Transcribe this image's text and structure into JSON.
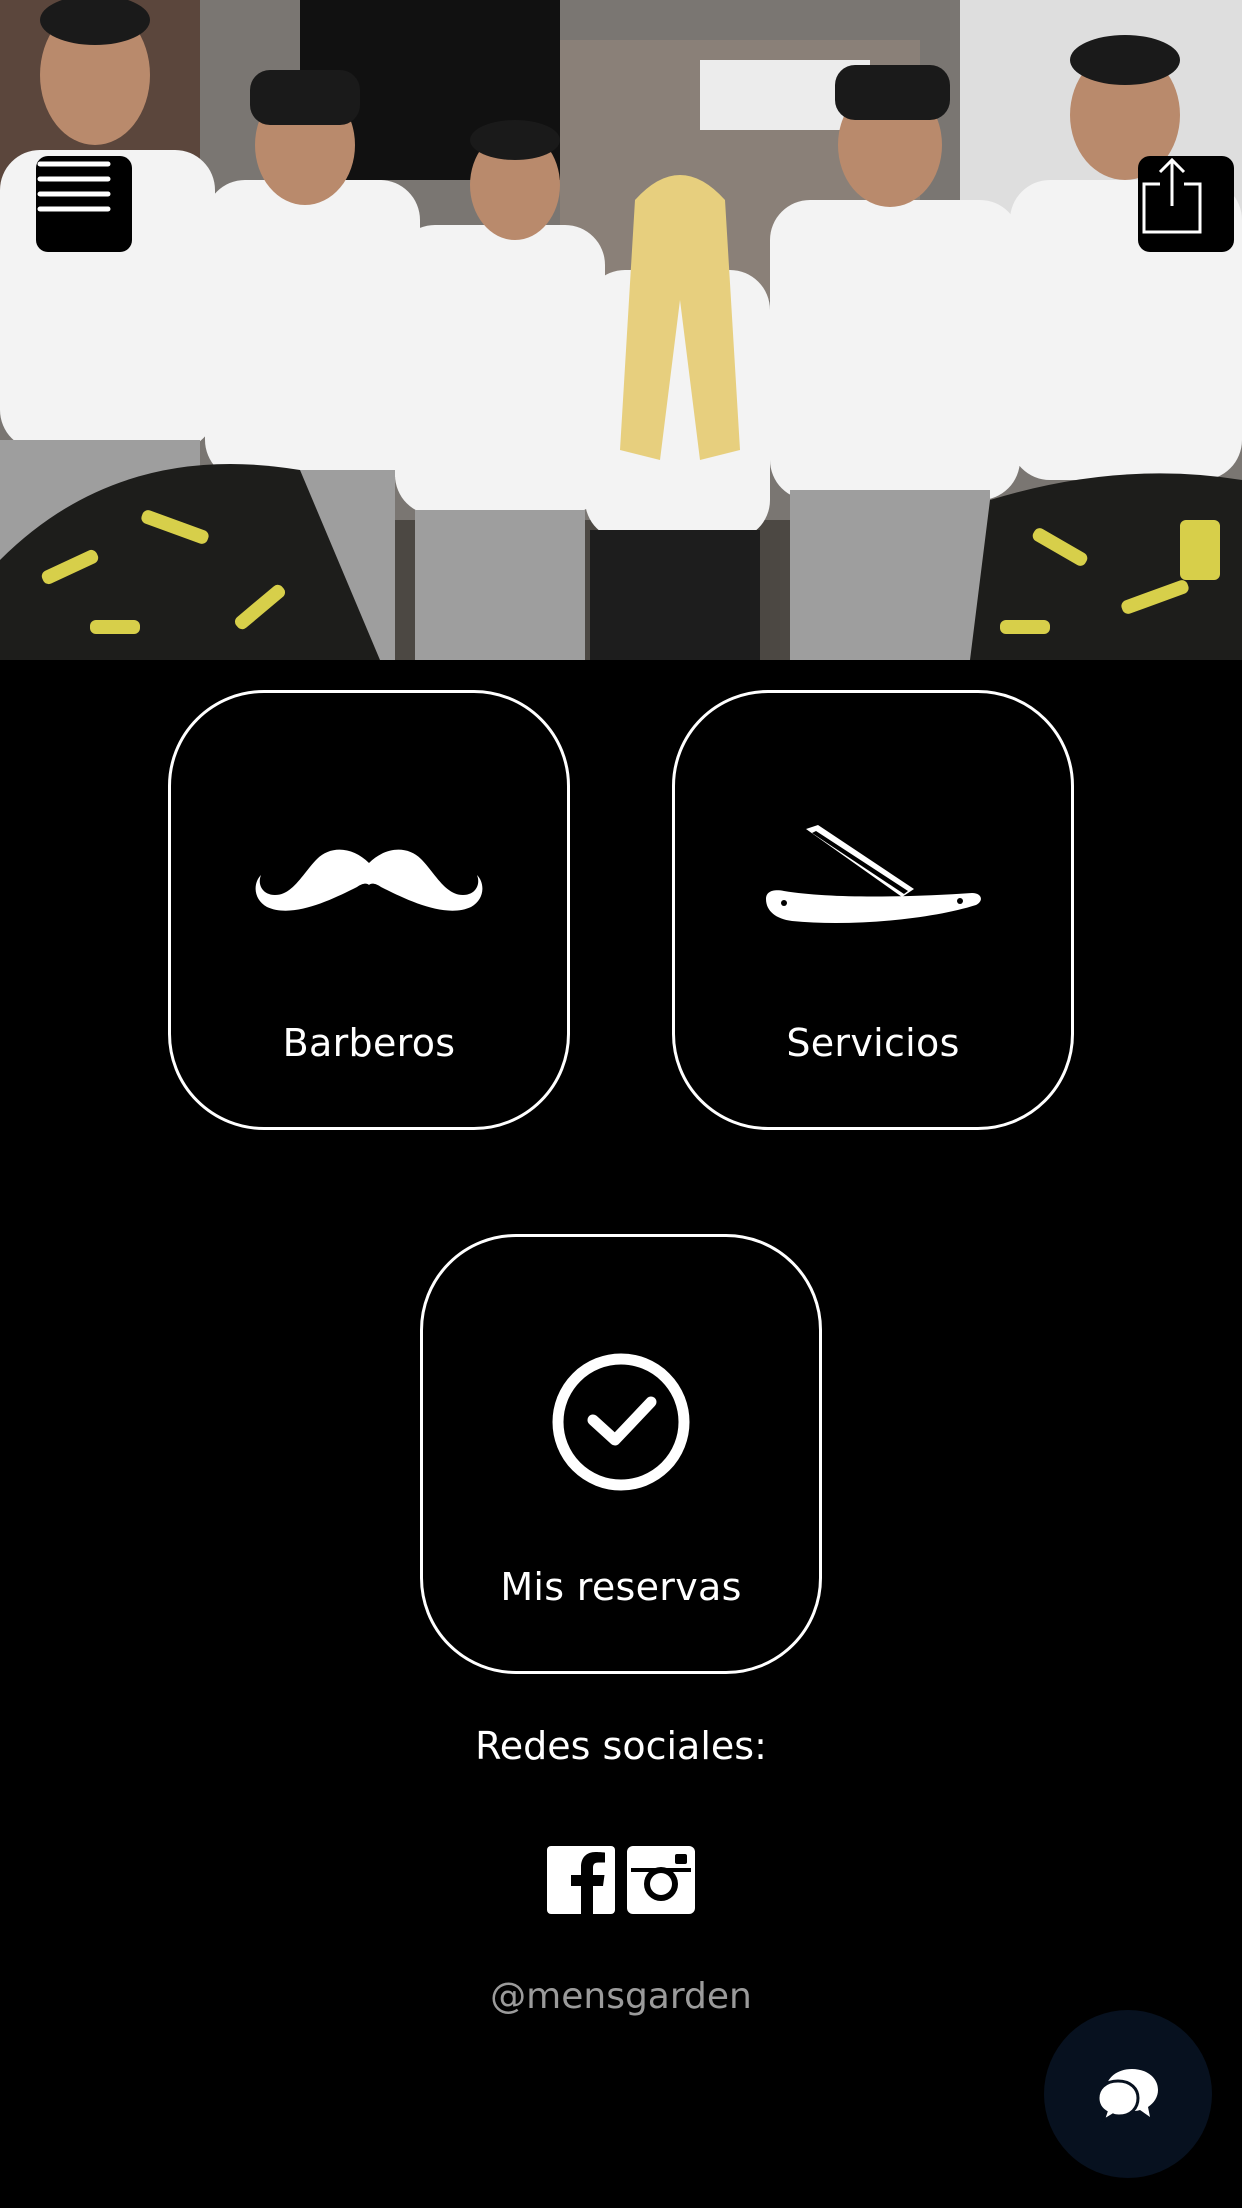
{
  "header": {
    "menu_icon": "hamburger-menu-icon",
    "share_icon": "share-icon"
  },
  "cards": {
    "barberos": {
      "label": "Barberos",
      "icon": "mustache-icon"
    },
    "servicios": {
      "label": "Servicios",
      "icon": "straight-razor-icon"
    },
    "reservas": {
      "label": "Mis reservas",
      "icon": "check-circle-icon"
    }
  },
  "social": {
    "title": "Redes sociales:",
    "icons": [
      "facebook-icon",
      "instagram-icon"
    ],
    "handle": "@mensgarden"
  },
  "chat": {
    "icon": "chat-bubbles-icon"
  },
  "colors": {
    "background": "#000000",
    "card_border": "#ffffff",
    "handle_text": "#9b9b9b",
    "chat_button": "#07111f",
    "cape_yellow": "#d7cf4a"
  }
}
